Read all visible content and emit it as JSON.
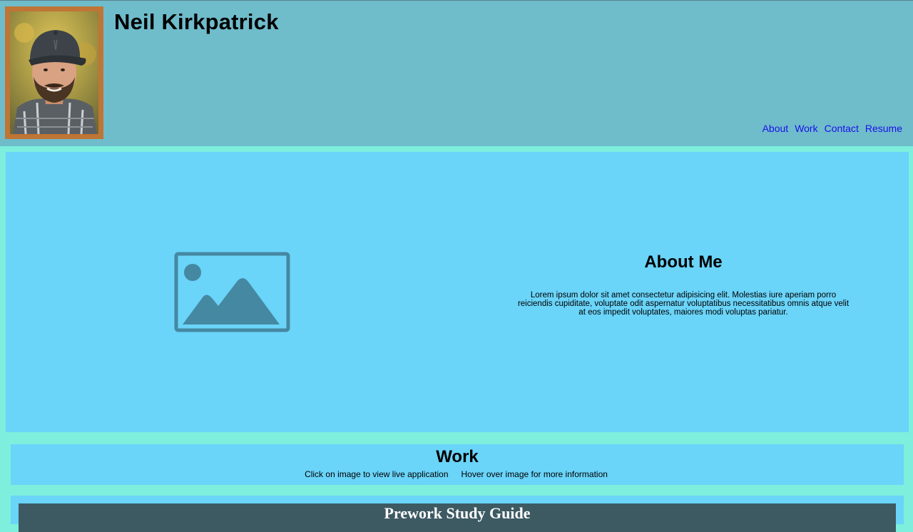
{
  "header": {
    "name": "Neil Kirkpatrick",
    "nav": [
      {
        "label": "About"
      },
      {
        "label": "Work"
      },
      {
        "label": "Contact"
      },
      {
        "label": "Resume"
      }
    ]
  },
  "about": {
    "title": "About Me",
    "body": "Lorem ipsum dolor sit amet consectetur adipisicing elit. Molestias iure aperiam porro reiciendis cupiditate, voluptate odit aspernatur voluptatibus necessitatibus omnis atque velit at eos impedit voluptates, maiores modi voluptas pariatur.",
    "image_icon": "image-placeholder-icon"
  },
  "work": {
    "title": "Work",
    "instruction_click": "Click on image to view live application",
    "instruction_hover": "Hover over image for more information"
  },
  "projects": [
    {
      "title": "Prework Study Guide"
    }
  ],
  "colors": {
    "page_bg": "#7defdc",
    "header_bg": "#6fbccb",
    "section_bg": "#6ad4f9",
    "avatar_border": "#bf7535",
    "link": "#1a10e8",
    "placeholder_icon": "#4588a2",
    "project_card": "#3d5a63"
  }
}
